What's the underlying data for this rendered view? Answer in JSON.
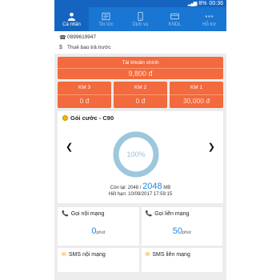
{
  "status": {
    "signal": "▂▄▆",
    "battery": "8%",
    "time": "00:36"
  },
  "nav": [
    {
      "label": "Cá nhân",
      "icon": "person-icon",
      "active": true
    },
    {
      "label": "Tin tức",
      "icon": "news-icon",
      "active": false
    },
    {
      "label": "Dịch vụ",
      "icon": "phone-icon",
      "active": false
    },
    {
      "label": "KNDL",
      "icon": "card-icon",
      "active": false
    },
    {
      "label": "Hỗ trợ",
      "icon": "more-icon",
      "active": false
    }
  ],
  "info": {
    "phone": "0899619947",
    "subscription": "Thuê bao trả trước"
  },
  "main_account": {
    "label": "Tài khoản chính",
    "value": "9,800 đ"
  },
  "km": [
    {
      "label": "KM 3",
      "value": "0 đ"
    },
    {
      "label": "KM 2",
      "value": "0 đ"
    },
    {
      "label": "KM 1",
      "value": "30,000 đ"
    }
  ],
  "plan": {
    "title": "Gói cước - C90",
    "percent_label": "100%",
    "percent": 100,
    "remain_prefix": "Còn lại: 2048 /",
    "remain_total": "2048",
    "remain_unit": "MB",
    "expiry": "Hết hạn: 10/09/2017 17:59:15"
  },
  "usage": [
    {
      "title": "Gọi nội mạng",
      "value": "0",
      "unit": "phút"
    },
    {
      "title": "Gọi liên mạng",
      "value": "50",
      "unit": "phút"
    },
    {
      "title": "SMS nội mạng"
    },
    {
      "title": "SMS liên mạng"
    }
  ],
  "colors": {
    "primary": "#1976d2",
    "accent": "#f26a3d",
    "value_blue": "#1e88e5"
  }
}
